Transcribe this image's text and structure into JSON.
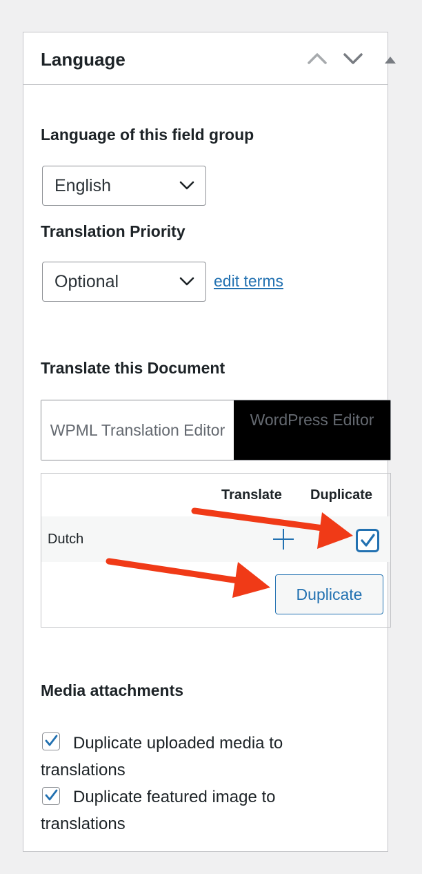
{
  "panel": {
    "title": "Language",
    "controls": {
      "move_up": "chevron-up",
      "move_down": "chevron-down",
      "toggle": "triangle-up"
    }
  },
  "field_group_language": {
    "label": "Language of this field group",
    "selected": "English"
  },
  "translation_priority": {
    "label": "Translation Priority",
    "selected": "Optional",
    "edit_link": "edit terms"
  },
  "translate_document": {
    "label": "Translate this Document",
    "tabs": [
      {
        "label": "WPML Translation Editor",
        "active": false
      },
      {
        "label": "WordPress Editor",
        "active": true
      }
    ],
    "table": {
      "headers": {
        "translate": "Translate",
        "duplicate": "Duplicate"
      },
      "rows": [
        {
          "language": "Dutch",
          "translate": "plus-icon",
          "duplicate_checked": true
        }
      ],
      "duplicate_button": "Duplicate"
    }
  },
  "media": {
    "label": "Media attachments",
    "options": [
      {
        "label_line1": "Duplicate uploaded media to",
        "label_line2": "translations",
        "checked": true
      },
      {
        "label_line1": "Duplicate featured image to",
        "label_line2": "translations",
        "checked": true
      }
    ]
  },
  "colors": {
    "accent": "#2271b1",
    "arrow": "#f03a17",
    "text": "#1d2327",
    "muted": "#646970"
  }
}
